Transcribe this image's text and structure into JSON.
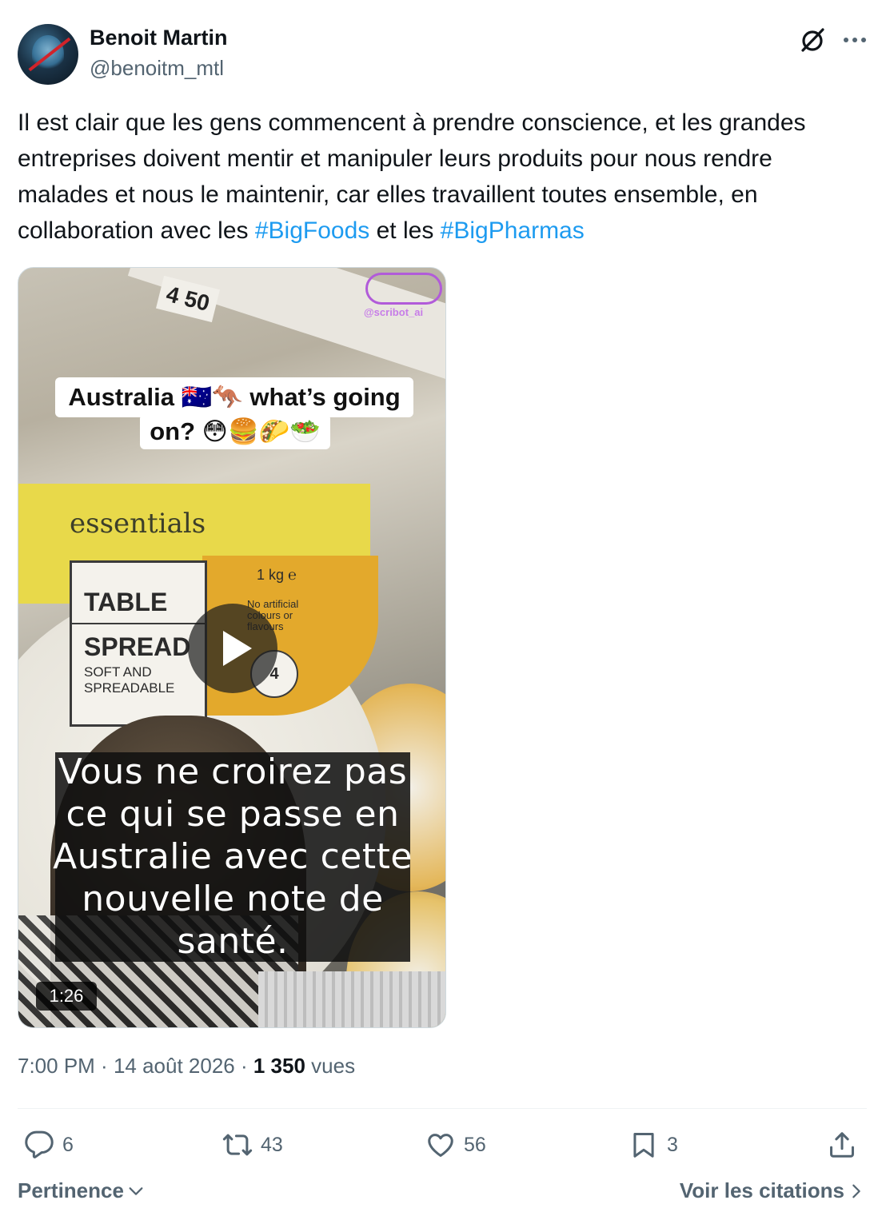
{
  "author": {
    "name": "Benoit Martin",
    "handle": "@benoitm_mtl"
  },
  "header_icons": [
    "grok-icon",
    "more-options-icon"
  ],
  "tweet": {
    "text_before": "Il est clair que les gens commencent à prendre conscience, et les grandes entreprises doivent mentir et manipuler leurs produits pour nous rendre malades et nous le maintenir, car elles travaillent toutes ensemble, en collaboration avec les ",
    "hashtag1": "#BigFoods",
    "text_between": " et les ",
    "hashtag2": "#BigPharmas",
    "hashtag_color": "#1d9bf0"
  },
  "video": {
    "price_tag": "4 50",
    "watermark": "@scribot_ai",
    "caption_line1": "Australia 🇦🇺🦘 what’s going",
    "caption_line2": "on? 😳🍔🌮🥗",
    "product_brand": "essentials",
    "product_word1": "TABLE",
    "product_word2": "SPREAD",
    "product_sub": "SOFT AND SPREADABLE",
    "product_weight": "1 kg ℮",
    "product_claim": "No artificial colours or flavours",
    "health_star": "4",
    "subtitle": "Vous ne croirez pas ce qui se passe en Australie avec cette nouvelle note de santé.",
    "duration": "1:26"
  },
  "meta": {
    "time": "7:00 PM",
    "sep1": " · ",
    "date": "14 août 2026",
    "sep2": " · ",
    "views_count": "1 350",
    "views_label": " vues"
  },
  "actions": {
    "replies": "6",
    "reposts": "43",
    "likes": "56",
    "bookmarks": "3"
  },
  "footer": {
    "sort_label": "Pertinence",
    "quotes_label": "Voir les citations"
  }
}
